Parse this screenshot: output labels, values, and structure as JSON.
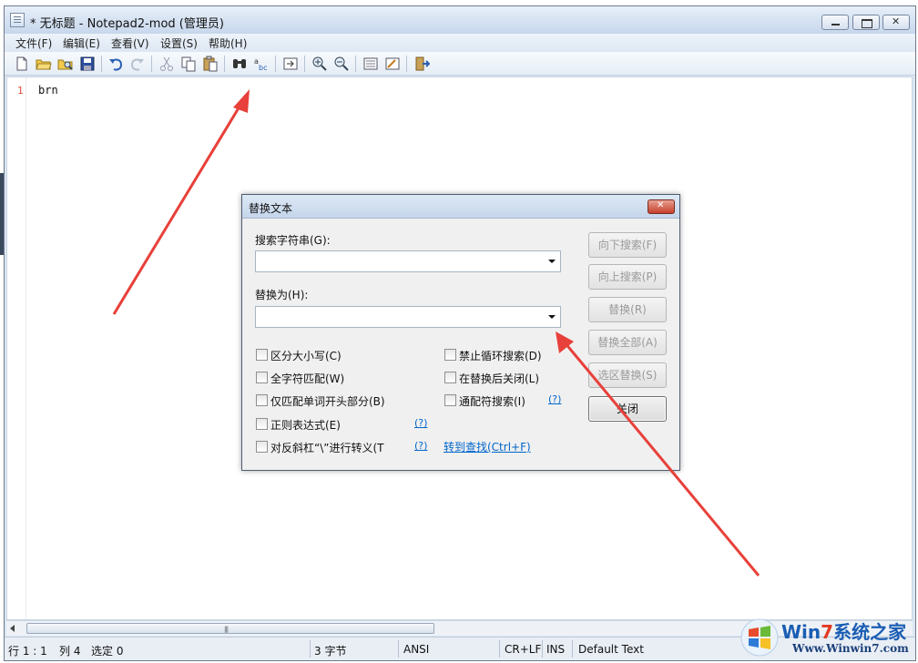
{
  "window": {
    "title": "* 无标题 - Notepad2-mod (管理员)"
  },
  "menu": [
    "文件(F)",
    "编辑(E)",
    "查看(V)",
    "设置(S)",
    "帮助(H)"
  ],
  "toolbar": {
    "icons": [
      "new-file-icon",
      "open-folder-icon",
      "browse-icon",
      "save-icon",
      "undo-icon",
      "redo-icon",
      "cut-icon",
      "copy-icon",
      "paste-icon",
      "find-icon",
      "replace-icon",
      "goto-icon",
      "zoom-in-icon",
      "zoom-out-icon",
      "scheme-icon",
      "customize-scheme-icon",
      "exit-icon"
    ]
  },
  "editor": {
    "line_number": "1",
    "text": "brn"
  },
  "status": {
    "position": "行 1 : 1",
    "column": "列 4",
    "selection": "选定 0",
    "size": "3 字节",
    "encoding": "ANSI",
    "line_ending": "CR+LF",
    "mode": "INS",
    "scheme": "Default Text"
  },
  "dialog": {
    "title": "替换文本",
    "search_label": "搜索字符串(G):",
    "search_value": "",
    "replace_label": "替换为(H):",
    "replace_value": "",
    "options": {
      "match_case": "区分大小写(C)",
      "whole_word": "全字符匹配(W)",
      "word_start": "仅匹配单词开头部分(B)",
      "regex": "正则表达式(E)",
      "escape": "对反斜杠“\\”进行转义(T",
      "no_wrap": "禁止循环搜索(D)",
      "close_after": "在替换后关闭(L)",
      "wildcard": "通配符搜索(I)"
    },
    "help_link": "(?)",
    "goto_link": "转到查找(Ctrl+F)",
    "buttons": {
      "find_next": "向下搜索(F)",
      "find_prev": "向上搜索(P)",
      "replace": "替换(R)",
      "replace_all": "替换全部(A)",
      "replace_in_sel": "选区替换(S)",
      "close": "关闭"
    }
  },
  "watermark": {
    "brand_prefix": "Win",
    "brand_seven": "7",
    "brand_suffix": "系统之家",
    "url": "Www.Winwin7.com"
  },
  "colors": {
    "annotation_arrow": "#e8403a",
    "link": "#0066cc",
    "line_number": "#e24c3b"
  }
}
